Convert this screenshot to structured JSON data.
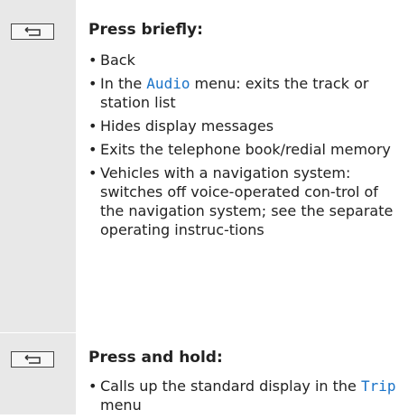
{
  "rows": [
    {
      "key_icon": "back-arrow-icon",
      "heading": "Press briefly:",
      "items": [
        {
          "text": "Back"
        },
        {
          "pre": "In the ",
          "keyword": "Audio",
          "post": " menu: exits the track or station list"
        },
        {
          "text": "Hides display messages"
        },
        {
          "text": "Exits the telephone book/redial memory"
        },
        {
          "text": "Vehicles with a navigation system: switches off voice-operated con-trol of the navigation system; see the separate operating instruc-tions"
        }
      ]
    },
    {
      "key_icon": "back-arrow-icon",
      "heading": "Press and hold:",
      "items": [
        {
          "pre": "Calls up the standard display in the ",
          "keyword": "Trip",
          "post": " menu"
        }
      ]
    }
  ],
  "colors": {
    "key_column_bg": "#e8e8e8",
    "keyword": "#1a73c8",
    "text": "#222222"
  }
}
